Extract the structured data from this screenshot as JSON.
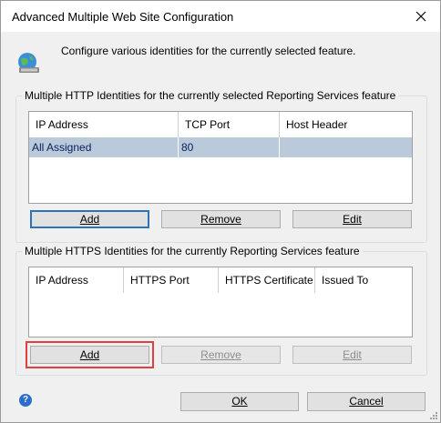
{
  "window": {
    "title": "Advanced Multiple Web Site Configuration",
    "description": "Configure various identities for the currently selected feature."
  },
  "http_group": {
    "label": "Multiple HTTP Identities for the currently selected Reporting Services feature",
    "columns": [
      "IP Address",
      "TCP Port",
      "Host Header"
    ],
    "rows": [
      {
        "ip": "All Assigned",
        "port": "80",
        "host": ""
      }
    ],
    "buttons": {
      "add": "Add",
      "remove": "Remove",
      "edit": "Edit"
    }
  },
  "https_group": {
    "label": "Multiple HTTPS Identities for the currently Reporting Services feature",
    "columns": [
      "IP Address",
      "HTTPS Port",
      "HTTPS Certificate",
      "Issued To"
    ],
    "buttons": {
      "add": "Add",
      "remove": "Remove",
      "edit": "Edit"
    }
  },
  "footer": {
    "ok": "OK",
    "cancel": "Cancel"
  },
  "colors": {
    "selected_row": "#bacadb",
    "highlight": "#e0403e",
    "default_button_border": "#2f73b6"
  }
}
